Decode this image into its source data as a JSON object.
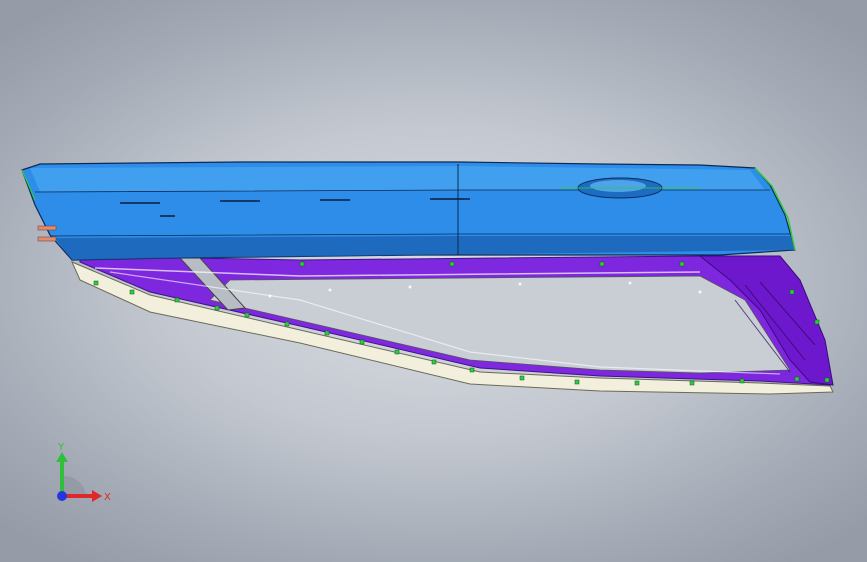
{
  "viewport": {
    "background": [
      "#d9dde3",
      "#959ca8"
    ],
    "content": "cad-model-car-door-assembly"
  },
  "model": {
    "colors": {
      "outer_panel": "#2d8de8",
      "outer_panel_light": "#4aa6f2",
      "outer_panel_dark": "#1a5fb0",
      "inner_frame": "#7a1fe0",
      "inner_frame_dark": "#4b0fa0",
      "seal_strip": "#f2f0dc",
      "clip_marker": "#2ecc40",
      "edge_line": "#0c2a55"
    }
  },
  "triad": {
    "x_label": "X",
    "y_label": "Y",
    "x_color": "#e0282a",
    "y_color": "#2fbf3a",
    "z_color": "#2436e0"
  }
}
